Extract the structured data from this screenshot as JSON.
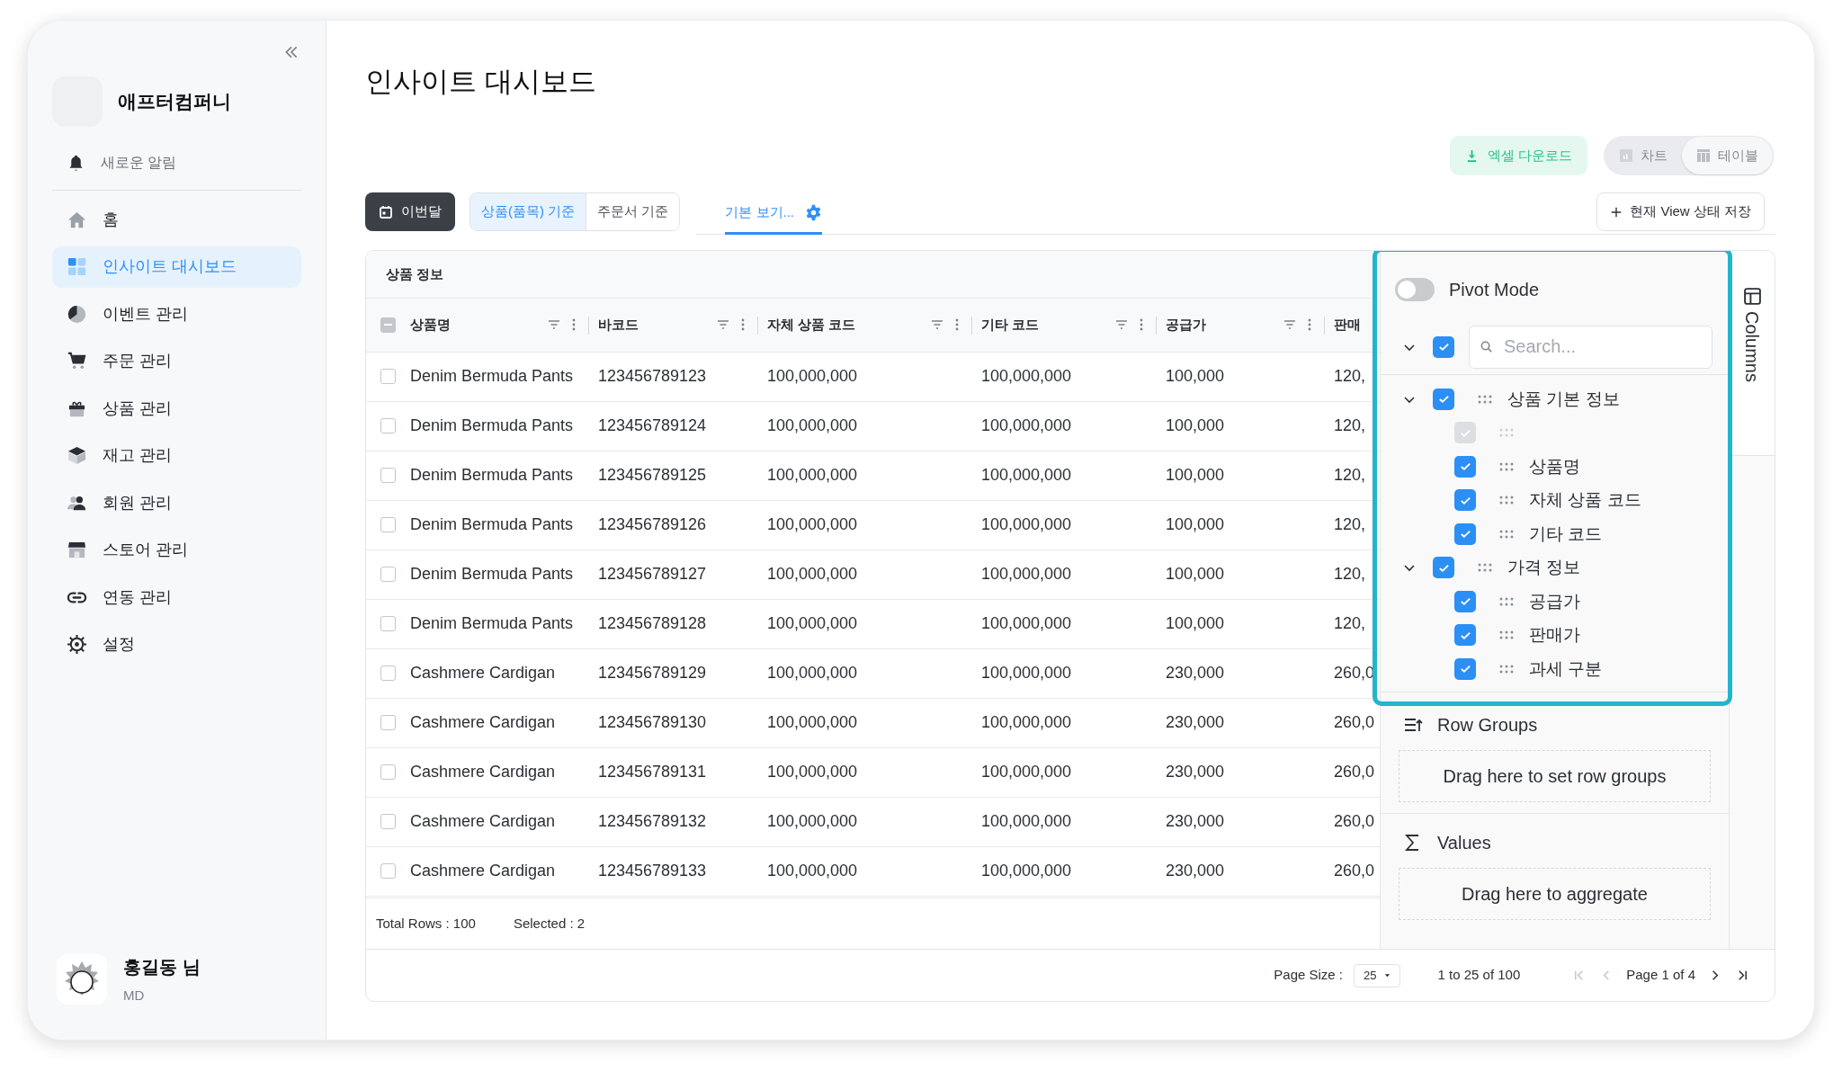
{
  "sidebar": {
    "company": "애프터컴퍼니",
    "notification": "새로운 알림",
    "items": [
      {
        "label": "홈",
        "selected": false
      },
      {
        "label": "인사이트 대시보드",
        "selected": true
      },
      {
        "label": "이벤트 관리",
        "selected": false
      },
      {
        "label": "주문 관리",
        "selected": false
      },
      {
        "label": "상품 관리",
        "selected": false
      },
      {
        "label": "재고 관리",
        "selected": false
      },
      {
        "label": "회원 관리",
        "selected": false
      },
      {
        "label": "스토어 관리",
        "selected": false
      },
      {
        "label": "연동 관리",
        "selected": false
      },
      {
        "label": "설정",
        "selected": false
      }
    ],
    "user": {
      "name": "홍길동 님",
      "role": "MD"
    }
  },
  "page": {
    "title": "인사이트 대시보드"
  },
  "actions": {
    "excel": "엑셀 다운로드",
    "view_toggle": {
      "disabled": true,
      "options": [
        {
          "label": "차트",
          "selected": false
        },
        {
          "label": "테이블",
          "selected": true
        }
      ]
    }
  },
  "filters": {
    "period": "이번달",
    "basis": [
      {
        "label": "상품(품목) 기준",
        "selected": true
      },
      {
        "label": "주문서 기준",
        "selected": false
      }
    ],
    "view_tab": {
      "label": "기본 보기...",
      "selected": true
    },
    "save_view": "현재 View 상태 저장"
  },
  "grid": {
    "group_header": "상품 정보",
    "header_checkbox": {
      "indeterminate": true
    },
    "columns": [
      "상품명",
      "바코드",
      "자체 상품 코드",
      "기타 코드",
      "공급가",
      "판매"
    ],
    "rows": [
      {
        "checked": false,
        "cells": [
          "Denim Bermuda Pants",
          "123456789123",
          "100,000,000",
          "100,000,000",
          "100,000",
          "120,"
        ]
      },
      {
        "checked": false,
        "cells": [
          "Denim Bermuda Pants",
          "123456789124",
          "100,000,000",
          "100,000,000",
          "100,000",
          "120,"
        ]
      },
      {
        "checked": false,
        "cells": [
          "Denim Bermuda Pants",
          "123456789125",
          "100,000,000",
          "100,000,000",
          "100,000",
          "120,"
        ]
      },
      {
        "checked": false,
        "cells": [
          "Denim Bermuda Pants",
          "123456789126",
          "100,000,000",
          "100,000,000",
          "100,000",
          "120,"
        ]
      },
      {
        "checked": false,
        "cells": [
          "Denim Bermuda Pants",
          "123456789127",
          "100,000,000",
          "100,000,000",
          "100,000",
          "120,"
        ]
      },
      {
        "checked": false,
        "cells": [
          "Denim Bermuda Pants",
          "123456789128",
          "100,000,000",
          "100,000,000",
          "100,000",
          "120,"
        ]
      },
      {
        "checked": false,
        "cells": [
          "Cashmere Cardigan",
          "123456789129",
          "100,000,000",
          "100,000,000",
          "230,000",
          "260,0"
        ]
      },
      {
        "checked": false,
        "cells": [
          "Cashmere Cardigan",
          "123456789130",
          "100,000,000",
          "100,000,000",
          "230,000",
          "260,0"
        ]
      },
      {
        "checked": false,
        "cells": [
          "Cashmere Cardigan",
          "123456789131",
          "100,000,000",
          "100,000,000",
          "230,000",
          "260,0"
        ]
      },
      {
        "checked": false,
        "cells": [
          "Cashmere Cardigan",
          "123456789132",
          "100,000,000",
          "100,000,000",
          "230,000",
          "260,0"
        ]
      },
      {
        "checked": false,
        "cells": [
          "Cashmere Cardigan",
          "123456789133",
          "100,000,000",
          "100,000,000",
          "230,000",
          "260,0"
        ]
      }
    ],
    "status": {
      "total": "Total Rows : 100",
      "selected": "Selected : 2"
    },
    "pagination": {
      "page_size_label": "Page Size :",
      "page_size": "25",
      "range": "1 to 25 of 100",
      "page": "Page 1 of 4",
      "buttons": [
        {
          "disabled": true
        },
        {
          "disabled": true
        },
        {
          "disabled": false
        },
        {
          "disabled": false
        }
      ]
    }
  },
  "tool_panel": {
    "pivot_mode": {
      "label": "Pivot Mode",
      "on": false
    },
    "select_all": {
      "checked": true,
      "expanded": true
    },
    "search": {
      "placeholder": "Search..."
    },
    "tree": [
      {
        "label": "상품 기본 정보",
        "checked": true,
        "expanded": true,
        "children": [
          {
            "checked": true,
            "disabled": true
          },
          {
            "label": "상품명",
            "checked": true,
            "disabled": false
          },
          {
            "label": "자체 상품 코드",
            "checked": true,
            "disabled": false
          },
          {
            "label": "기타 코드",
            "checked": true,
            "disabled": false
          }
        ]
      },
      {
        "label": "가격 정보",
        "checked": true,
        "expanded": true,
        "children": [
          {
            "label": "공급가",
            "checked": true,
            "disabled": false
          },
          {
            "label": "판매가",
            "checked": true,
            "disabled": false
          },
          {
            "label": "과세 구분",
            "checked": true,
            "disabled": false
          }
        ]
      }
    ],
    "row_groups": {
      "label": "Row Groups",
      "drop_hint": "Drag here to set row groups"
    },
    "values": {
      "label": "Values",
      "drop_hint": "Drag here to aggregate"
    },
    "side_tab": {
      "label": "Columns"
    }
  }
}
